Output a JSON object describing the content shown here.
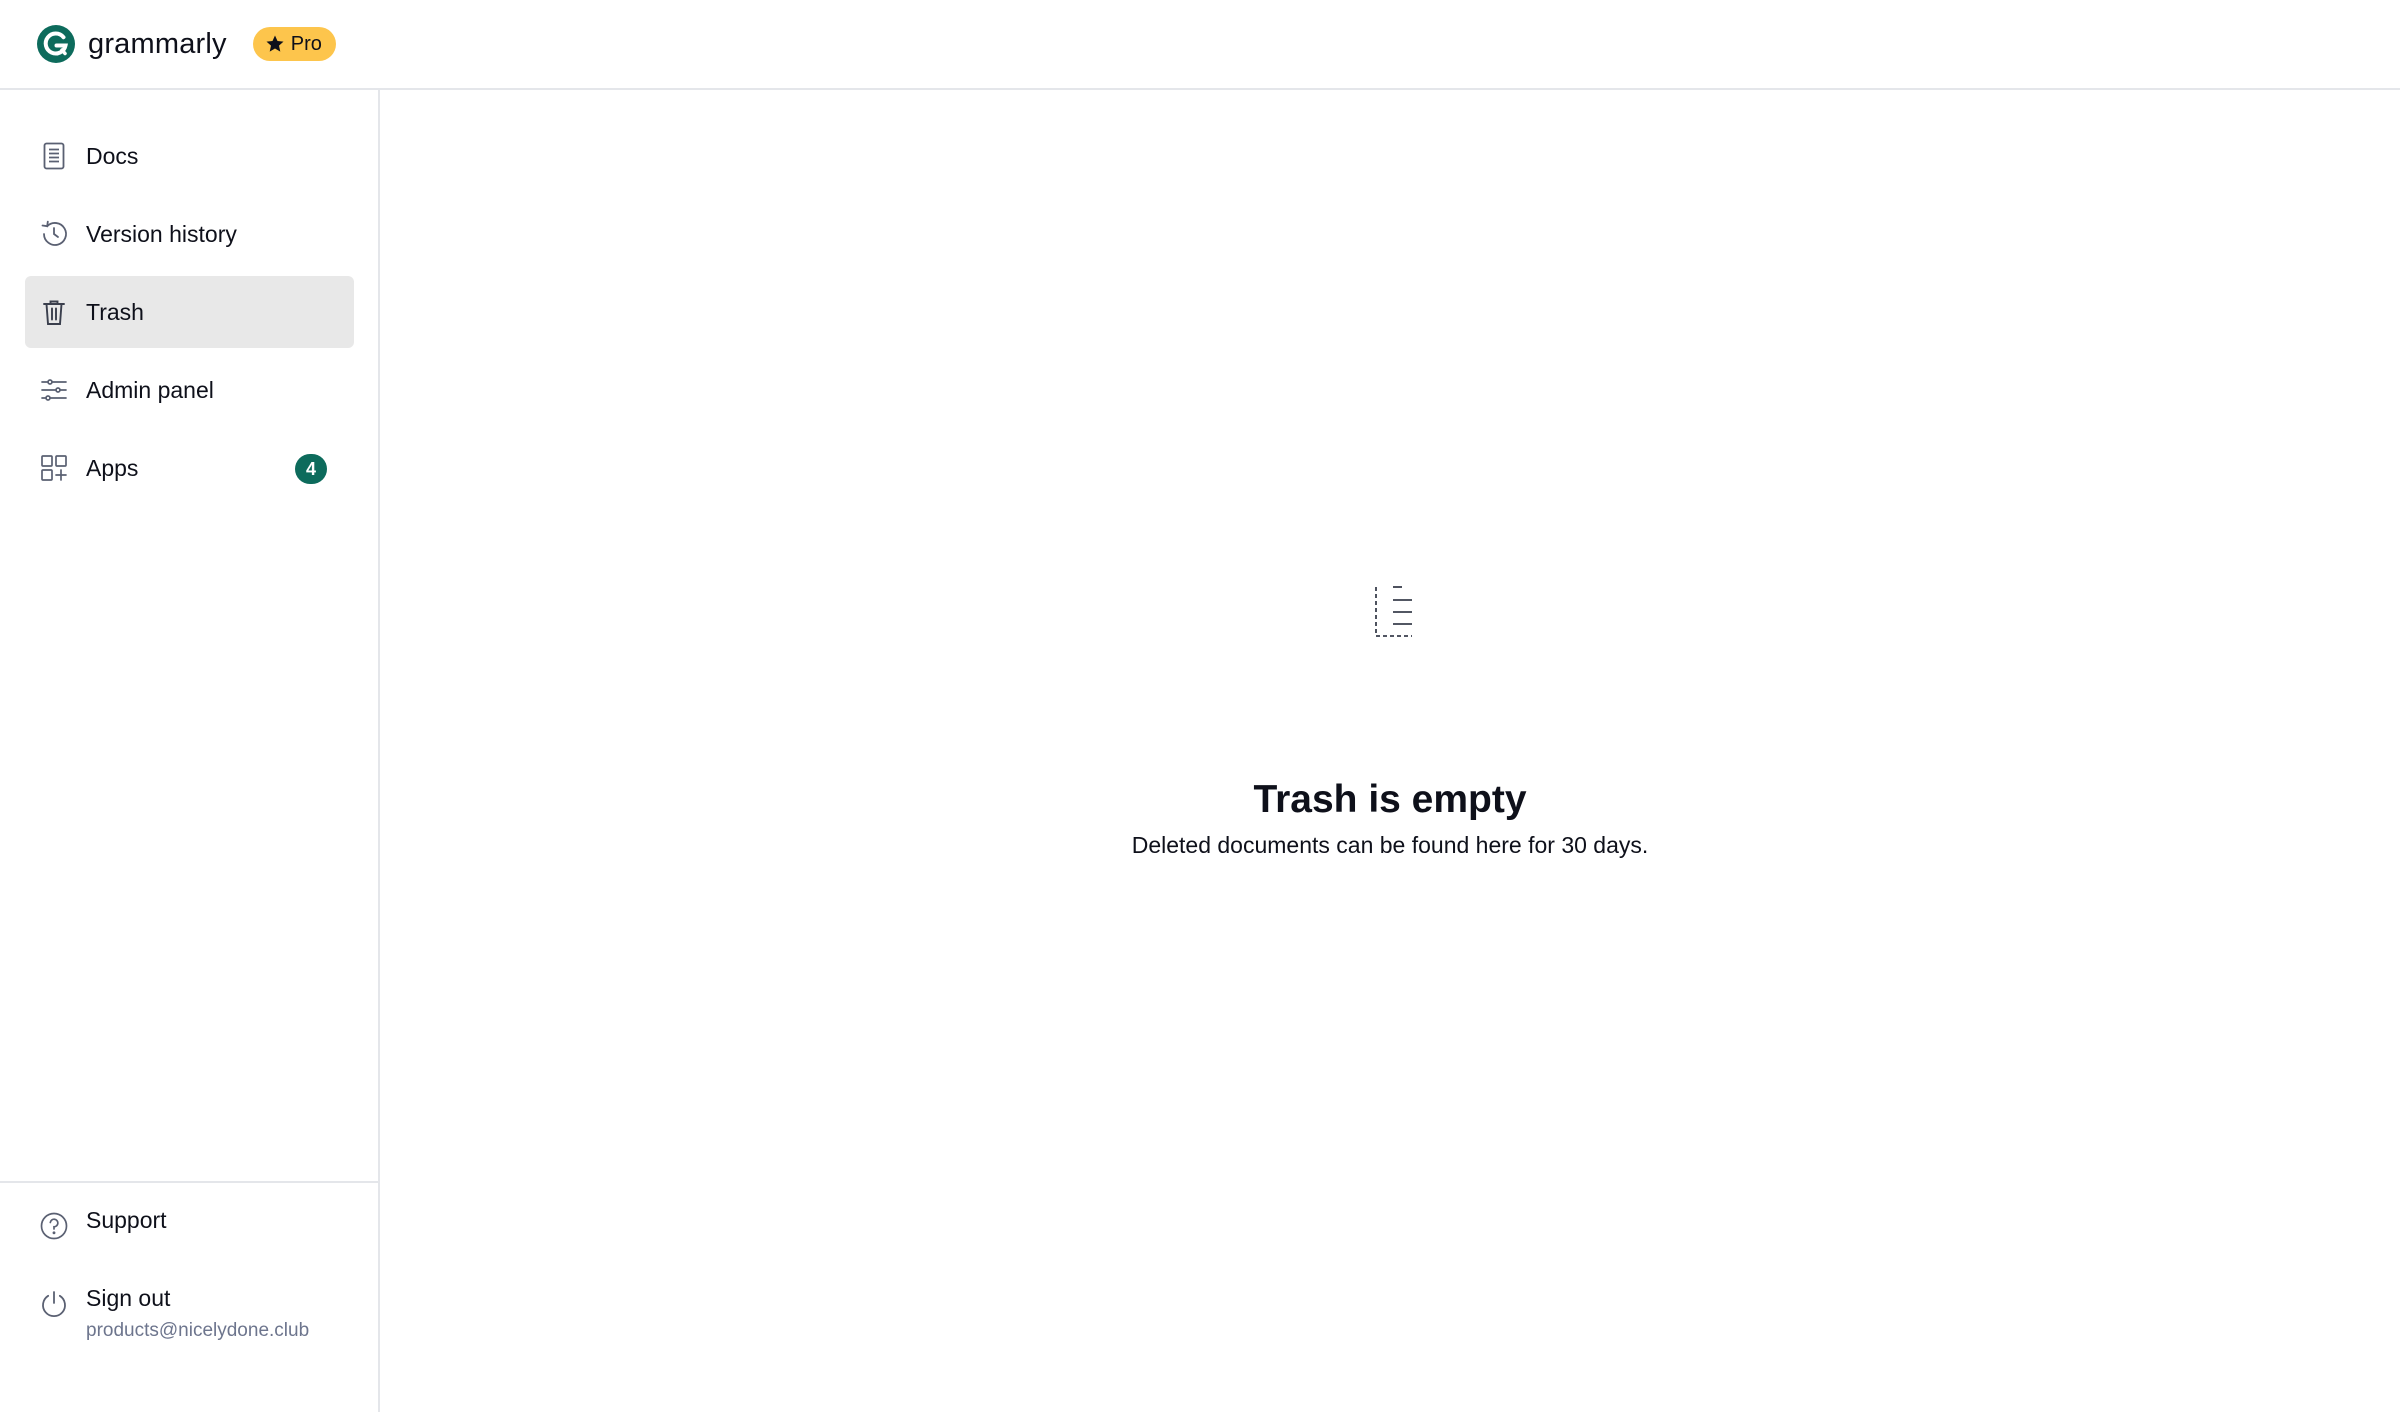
{
  "brand": {
    "name": "grammarly",
    "plan_badge": "Pro",
    "brand_color": "#15c39a",
    "logo_color": "#0d6b5c"
  },
  "sidebar": {
    "items": [
      {
        "label": "Docs",
        "icon": "document-icon",
        "active": false
      },
      {
        "label": "Version history",
        "icon": "history-icon",
        "active": false
      },
      {
        "label": "Trash",
        "icon": "trash-icon",
        "active": true
      },
      {
        "label": "Admin panel",
        "icon": "sliders-icon",
        "active": false
      },
      {
        "label": "Apps",
        "icon": "apps-grid-icon",
        "active": false,
        "badge": "4"
      }
    ],
    "bottom": {
      "support_label": "Support",
      "signout_label": "Sign out",
      "account_email": "products@nicelydone.club"
    }
  },
  "main": {
    "empty_state": {
      "icon": "empty-document-icon",
      "title": "Trash is empty",
      "subtitle": "Deleted documents can be found here for 30 days."
    }
  },
  "colors": {
    "active_item_bg": "#e8e8e8",
    "badge_bg": "#0d6b5c",
    "pro_badge_bg": "#fdc54c",
    "divider": "#e4e6ea"
  }
}
